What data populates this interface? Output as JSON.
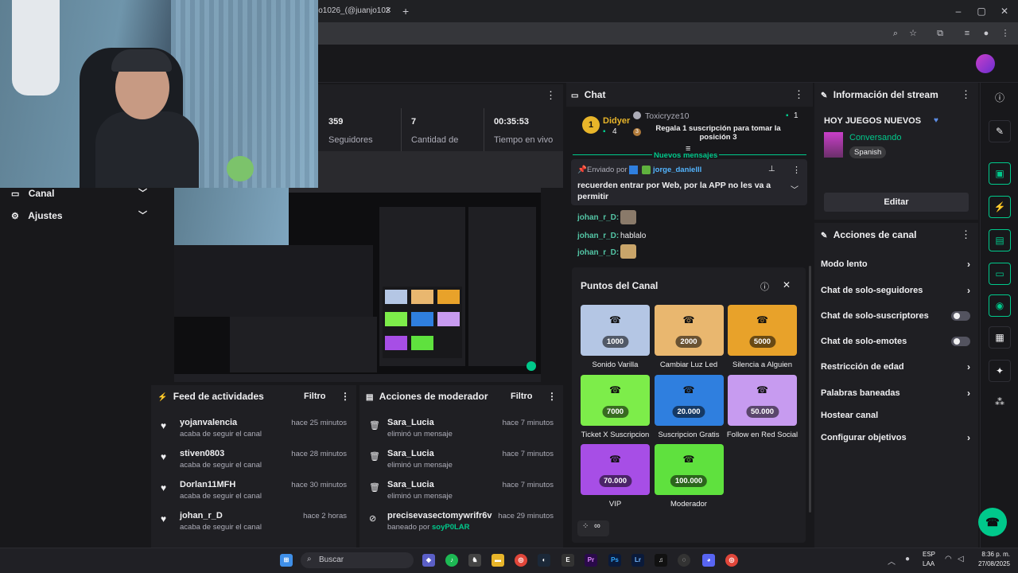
{
  "browser": {
    "tab_title": "jo1026_(@juanjo102",
    "new_tab": "+",
    "window_controls": [
      "–",
      "▢",
      "✕"
    ]
  },
  "sidebar": {
    "items": [
      {
        "label": "Canal"
      },
      {
        "label": "Ajustes"
      }
    ]
  },
  "stats": {
    "items": [
      {
        "value": "359",
        "label": "Seguidores"
      },
      {
        "value": "7",
        "label": "Cantidad de"
      },
      {
        "value": "00:35:53",
        "label": "Tiempo en vivo"
      }
    ],
    "menu": "⋮"
  },
  "activity_feed": {
    "title": "Feed de actividades",
    "filter": "Filtro",
    "items": [
      {
        "name": "yojanvalencia",
        "action": "acaba de seguir el canal",
        "time": "hace 25 minutos"
      },
      {
        "name": "stiven0803",
        "action": "acaba de seguir el canal",
        "time": "hace 28 minutos"
      },
      {
        "name": "Dorlan11MFH",
        "action": "acaba de seguir el canal",
        "time": "hace 30 minutos"
      },
      {
        "name": "johan_r_D",
        "action": "acaba de seguir el canal",
        "time": "hace 2 horas"
      }
    ]
  },
  "mod_actions": {
    "title": "Acciones de moderador",
    "filter": "Filtro",
    "items": [
      {
        "name": "Sara_Lucia",
        "action": "eliminó un mensaje",
        "time": "hace 7 minutos"
      },
      {
        "name": "Sara_Lucia",
        "action": "eliminó un mensaje",
        "time": "hace 7 minutos"
      },
      {
        "name": "Sara_Lucia",
        "action": "eliminó un mensaje",
        "time": "hace 7 minutos"
      },
      {
        "name": "precisevasectomywrifr6v",
        "action": "baneado por",
        "by": "soyP0LAR",
        "time": "hace 29 minutos"
      }
    ]
  },
  "chat": {
    "title": "Chat",
    "gifter": {
      "rank": "1",
      "name": "Didyer",
      "count": "4"
    },
    "gift": {
      "user": "Toxicryze10",
      "count": "1",
      "rank": "3",
      "text": "Regala 1 suscripción para tomar la posición 3"
    },
    "new_messages": "Nuevos mensajes",
    "pinned": {
      "sent_by": "Enviado por",
      "user": "jorge_danielll",
      "text": "recuerden entrar por Web, por la APP no les va a permitir"
    },
    "messages": [
      {
        "user": "johan_r_D:",
        "text": ""
      },
      {
        "user": "johan_r_D:",
        "text": "hablalo"
      },
      {
        "user": "johan_r_D:",
        "text": ""
      }
    ]
  },
  "channel_points": {
    "title": "Puntos del Canal",
    "rewards": [
      {
        "price": "1000",
        "label": "Sonido Varilla",
        "color": "#b4c6e4"
      },
      {
        "price": "2000",
        "label": "Cambiar Luz Led",
        "color": "#e9b76f"
      },
      {
        "price": "5000",
        "label": "Silencia a Alguien",
        "color": "#e8a22a"
      },
      {
        "price": "7000",
        "label": "Ticket X Suscripcion",
        "color": "#7ded4a"
      },
      {
        "price": "20.000",
        "label": "Suscripcion Gratis",
        "color": "#2f7fdf"
      },
      {
        "price": "50.000",
        "label": "Follow en Red Social",
        "color": "#c79bf0"
      },
      {
        "price": "70.000",
        "label": "VIP",
        "color": "#a74ee6"
      },
      {
        "price": "100.000",
        "label": "Moderador",
        "color": "#5fe13e"
      }
    ],
    "footer": "∞"
  },
  "stream_info": {
    "title": "Información del stream",
    "stream_title": "HOY JUEGOS NUEVOS",
    "category": "Conversando",
    "language": "Spanish",
    "edit": "Editar"
  },
  "channel_actions": {
    "title": "Acciones de canal",
    "items": [
      {
        "label": "Modo lento",
        "kind": "chevron"
      },
      {
        "label": "Chat de solo-seguidores",
        "kind": "chevron"
      },
      {
        "label": "Chat de solo-suscriptores",
        "kind": "toggle"
      },
      {
        "label": "Chat de solo-emotes",
        "kind": "toggle"
      },
      {
        "label": "Restricción de edad",
        "kind": "chevron"
      },
      {
        "label": "Palabras baneadas",
        "kind": "chevron"
      },
      {
        "label": "Hostear canal",
        "kind": "none"
      },
      {
        "label": "Configurar objetivos",
        "kind": "chevron"
      }
    ]
  },
  "taskbar": {
    "search": "Buscar",
    "lang": "ESP",
    "lang2": "LAA",
    "time": "8:36 p. m.",
    "date": "27/08/2025"
  },
  "colors": {
    "accent": "#00c98b",
    "bg": "#18181b",
    "panel": "#1f1f23"
  }
}
